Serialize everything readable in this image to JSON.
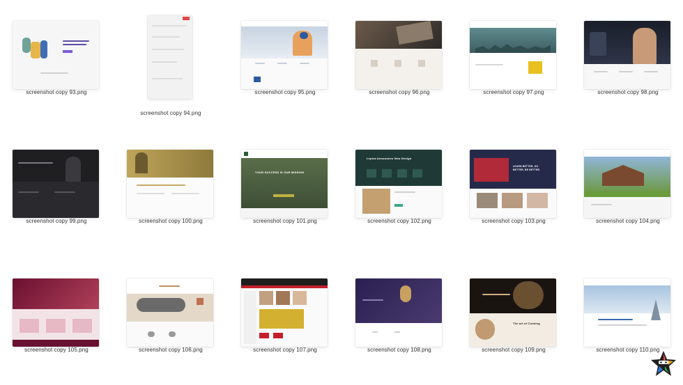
{
  "files": [
    {
      "name": "screenshot copy 93.png"
    },
    {
      "name": "screenshot copy 94.png"
    },
    {
      "name": "screenshot copy 95.png"
    },
    {
      "name": "screenshot copy 96.png"
    },
    {
      "name": "screenshot copy 97.png"
    },
    {
      "name": "screenshot copy 98.png"
    },
    {
      "name": "screenshot copy 99.png"
    },
    {
      "name": "screenshot copy 100.png"
    },
    {
      "name": "screenshot copy 101.png",
      "hero_text": "YOUR SUCCESS IS OUR MISSION"
    },
    {
      "name": "screenshot copy 102.png",
      "hero_text": "Lepiza Announces New Design"
    },
    {
      "name": "screenshot copy 103.png",
      "hero_text": "LEARN BETTER, DO BETTER, BE BETTER."
    },
    {
      "name": "screenshot copy 104.png"
    },
    {
      "name": "screenshot copy 105.png"
    },
    {
      "name": "screenshot copy 106.png"
    },
    {
      "name": "screenshot copy 107.png"
    },
    {
      "name": "screenshot copy 108.png"
    },
    {
      "name": "screenshot copy 109.png",
      "hero_text": "The art of Cooking"
    },
    {
      "name": "screenshot copy 110.png"
    }
  ],
  "colors": {
    "label_text": "#333333",
    "background": "#ffffff"
  }
}
